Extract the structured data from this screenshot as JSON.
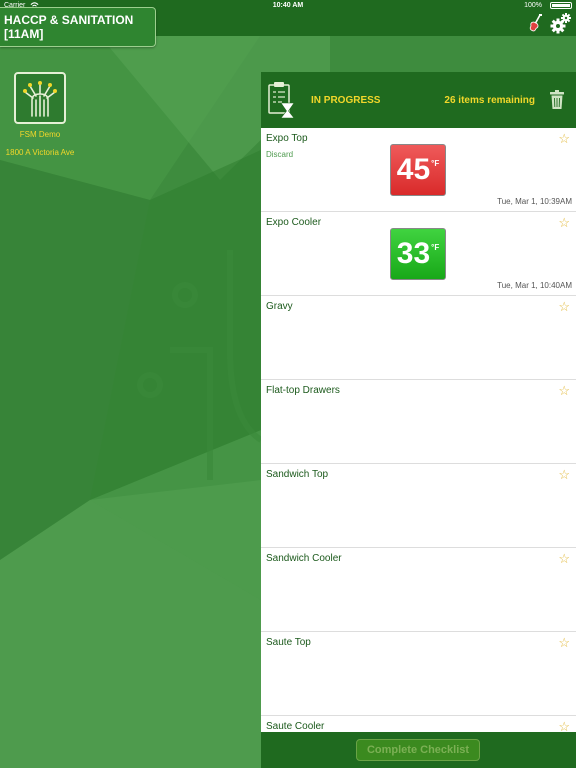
{
  "statusbar": {
    "carrier": "Carrier",
    "time": "10:40 AM",
    "battery": "100%",
    "battery_level": 1.0
  },
  "header": {
    "title": "HACCP & SANITATION [11AM]"
  },
  "sidebar": {
    "store_name": "FSM Demo",
    "store_address": "1800 A Victoria Ave"
  },
  "checklist": {
    "status": "IN PROGRESS",
    "remaining": "26 items remaining",
    "items": [
      {
        "name": "Expo Top",
        "note": "Discard",
        "temp": "45",
        "unit": "°F",
        "temp_status": "red",
        "time": "Tue, Mar 1, 10:39AM",
        "starred": false
      },
      {
        "name": "Expo Cooler",
        "note": "",
        "temp": "33",
        "unit": "°F",
        "temp_status": "green",
        "time": "Tue, Mar 1, 10:40AM",
        "starred": false
      },
      {
        "name": "Gravy",
        "starred": false
      },
      {
        "name": "Flat-top Drawers",
        "starred": false
      },
      {
        "name": "Sandwich Top",
        "starred": false
      },
      {
        "name": "Sandwich Cooler",
        "starred": false
      },
      {
        "name": "Saute Top",
        "starred": false
      },
      {
        "name": "Saute Cooler",
        "starred": false
      }
    ],
    "star_glyph": "☆",
    "complete_label": "Complete Checklist"
  },
  "colors": {
    "header_green": "#1f6a1f",
    "accent_yellow": "#f2d72a",
    "temp_bad": "#d92a2a",
    "temp_good": "#18a818"
  },
  "icons": {
    "guitar": "guitar-icon",
    "settings": "gear-icon",
    "clipboard": "clipboard-hourglass-icon",
    "trash": "trash-icon",
    "star": "star-outline-icon"
  }
}
